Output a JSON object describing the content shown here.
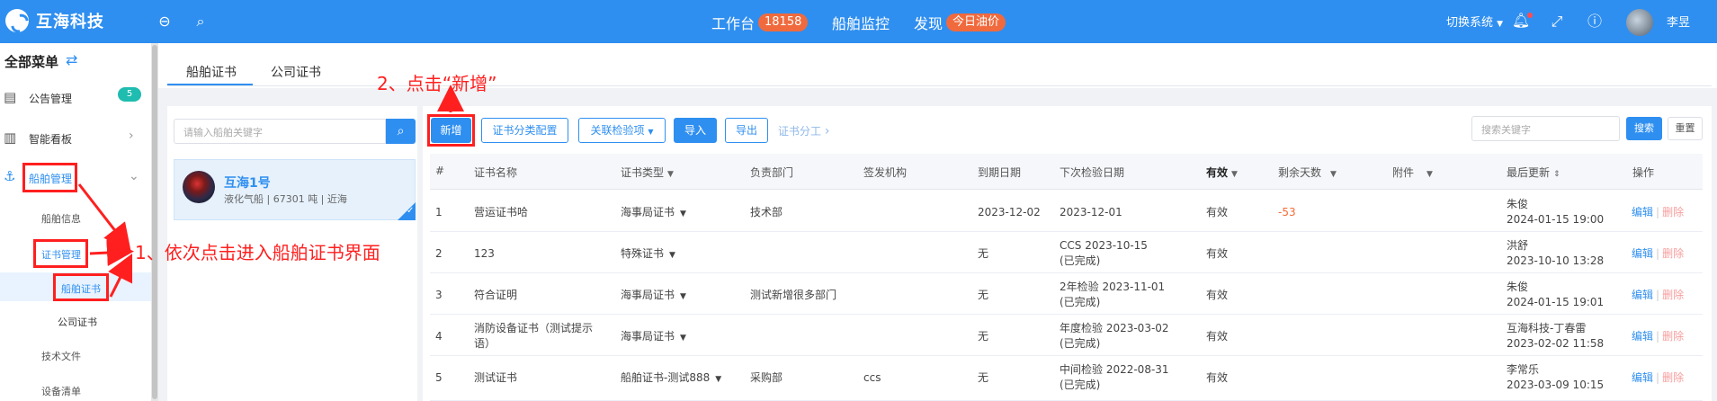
{
  "header": {
    "brand": "互海科技",
    "nav": [
      {
        "label": "工作台",
        "badge": "18158"
      },
      {
        "label": "船舶监控"
      },
      {
        "label": "发现",
        "badge": "今日油价"
      }
    ],
    "switch_system": "切换系统",
    "username": "李昱"
  },
  "sidebar": {
    "title": "全部菜单",
    "items": [
      {
        "label": "公告管理",
        "badge": "5"
      },
      {
        "label": "智能看板"
      },
      {
        "label": "船舶管理"
      },
      {
        "label": "船舶信息"
      },
      {
        "label": "证书管理"
      },
      {
        "label": "船舶证书"
      },
      {
        "label": "公司证书"
      },
      {
        "label": "技术文件"
      },
      {
        "label": "设备清单"
      }
    ]
  },
  "tabs": [
    "船舶证书",
    "公司证书"
  ],
  "ship_panel": {
    "search_placeholder": "请输入船舶关键字",
    "ship": {
      "name": "互海1号",
      "info": "液化气船 | 67301 吨 | 近海"
    }
  },
  "toolbar": {
    "add": "新增",
    "category_config": "证书分类配置",
    "related_inspection": "关联检验项",
    "import": "导入",
    "export": "导出",
    "division": "证书分工",
    "search_placeholder": "搜索关键字",
    "search": "搜索",
    "reset": "重置"
  },
  "table": {
    "columns": [
      "#",
      "证书名称",
      "证书类型",
      "负责部门",
      "签发机构",
      "到期日期",
      "下次检验日期",
      "有效",
      "剩余天数",
      "附件",
      "最后更新",
      "操作"
    ],
    "rows": [
      {
        "no": "1",
        "name": "营运证书哈",
        "type": "海事局证书",
        "dept": "技术部",
        "issuer": "",
        "expiry": "2023-12-02",
        "next1": "2023-12-01",
        "next2": "",
        "valid": "有效",
        "days": "-53",
        "upd_user": "朱俊",
        "upd_time": "2024-01-15 19:00"
      },
      {
        "no": "2",
        "name": "123",
        "type": "特殊证书",
        "dept": "",
        "issuer": "",
        "expiry": "无",
        "next1": "CCS 2023-10-15",
        "next2": "(已完成)",
        "valid": "有效",
        "days": "",
        "upd_user": "洪舒",
        "upd_time": "2023-10-10 13:28"
      },
      {
        "no": "3",
        "name": "符合证明",
        "type": "海事局证书",
        "dept": "测试新增很多部门",
        "issuer": "",
        "expiry": "无",
        "next1": "2年检验 2023-11-01",
        "next2": "(已完成)",
        "valid": "有效",
        "days": "",
        "upd_user": "朱俊",
        "upd_time": "2024-01-15 19:01"
      },
      {
        "no": "4",
        "name": "消防设备证书（测试提示",
        "name2": "语）",
        "type": "海事局证书",
        "dept": "",
        "issuer": "",
        "expiry": "无",
        "next1": "年度检验 2023-03-02",
        "next2": "(已完成)",
        "valid": "有效",
        "days": "",
        "upd_user": "互海科技-丁春雷",
        "upd_time": "2023-02-02 11:58"
      },
      {
        "no": "5",
        "name": "测试证书",
        "type": "船舶证书-测试888",
        "dept": "采购部",
        "issuer": "ccs",
        "expiry": "无",
        "next1": "中间检验 2022-08-31",
        "next2": "(已完成)",
        "valid": "有效",
        "days": "",
        "upd_user": "李常乐",
        "upd_time": "2023-03-09 10:15"
      }
    ],
    "op_edit": "编辑",
    "op_delete": "删除"
  },
  "annotations": {
    "step1": "1、依次点击进入船舶证书界面",
    "step2": "2、点击“新增”"
  },
  "colors": {
    "primary": "#2f8ff0",
    "annotation": "#ff1f1f",
    "badge_orange": "#f06a3d",
    "teal_badge": "#1fbcb0"
  }
}
